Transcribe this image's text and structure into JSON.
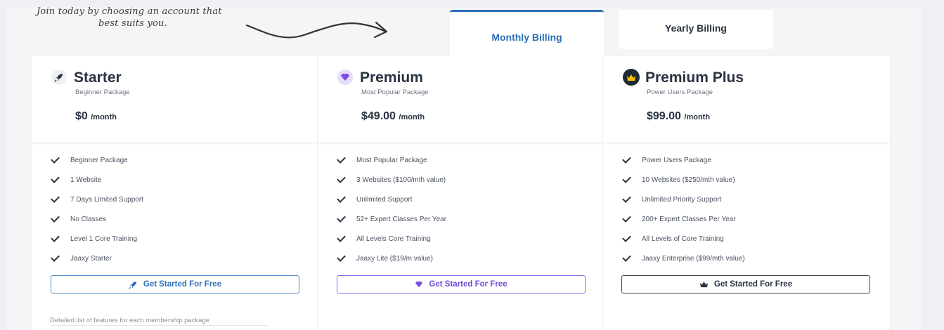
{
  "intro": {
    "line1": "Join today by choosing an account that",
    "line2": "best suits you."
  },
  "tabs": [
    {
      "label": "Monthly Billing",
      "active": true
    },
    {
      "label": "Yearly Billing",
      "active": false
    }
  ],
  "colors": {
    "accent_blue": "#2f6fb7",
    "premium_purple": "#7b4fe0",
    "dark": "#2a3342"
  },
  "plans": [
    {
      "name": "Starter",
      "subtitle": "Beginner Package",
      "price": "$0",
      "period": "/month",
      "icon": "rocket-icon",
      "features": [
        "Beginner Package",
        "1 Website",
        "7 Days Limited Support",
        "No Classes",
        "Level 1 Core Training",
        "Jaaxy Starter"
      ],
      "cta": "Get Started For Free"
    },
    {
      "name": "Premium",
      "subtitle": "Most Popular Package",
      "price": "$49.00",
      "period": "/month",
      "icon": "diamond-icon",
      "features": [
        "Most Popular Package",
        "3 Websites ($100/mth value)",
        "Unlimited Support",
        "52+ Expert Classes Per Year",
        "All Levels Core Training",
        "Jaaxy Lite ($19/m value)"
      ],
      "cta": "Get Started For Free"
    },
    {
      "name": "Premium Plus",
      "subtitle": "Power Users Package",
      "price": "$99.00",
      "period": "/month",
      "icon": "crown-icon",
      "features": [
        "Power Users Package",
        "10 Websites ($250/mth value)",
        "Unlimited Priority Support",
        "200+ Expert Classes Per Year",
        "All Levels of Core Training",
        "Jaaxy Enterprise ($99/mth value)"
      ],
      "cta": "Get Started For Free"
    }
  ],
  "footnote": "Detailed list of features for each membership package"
}
